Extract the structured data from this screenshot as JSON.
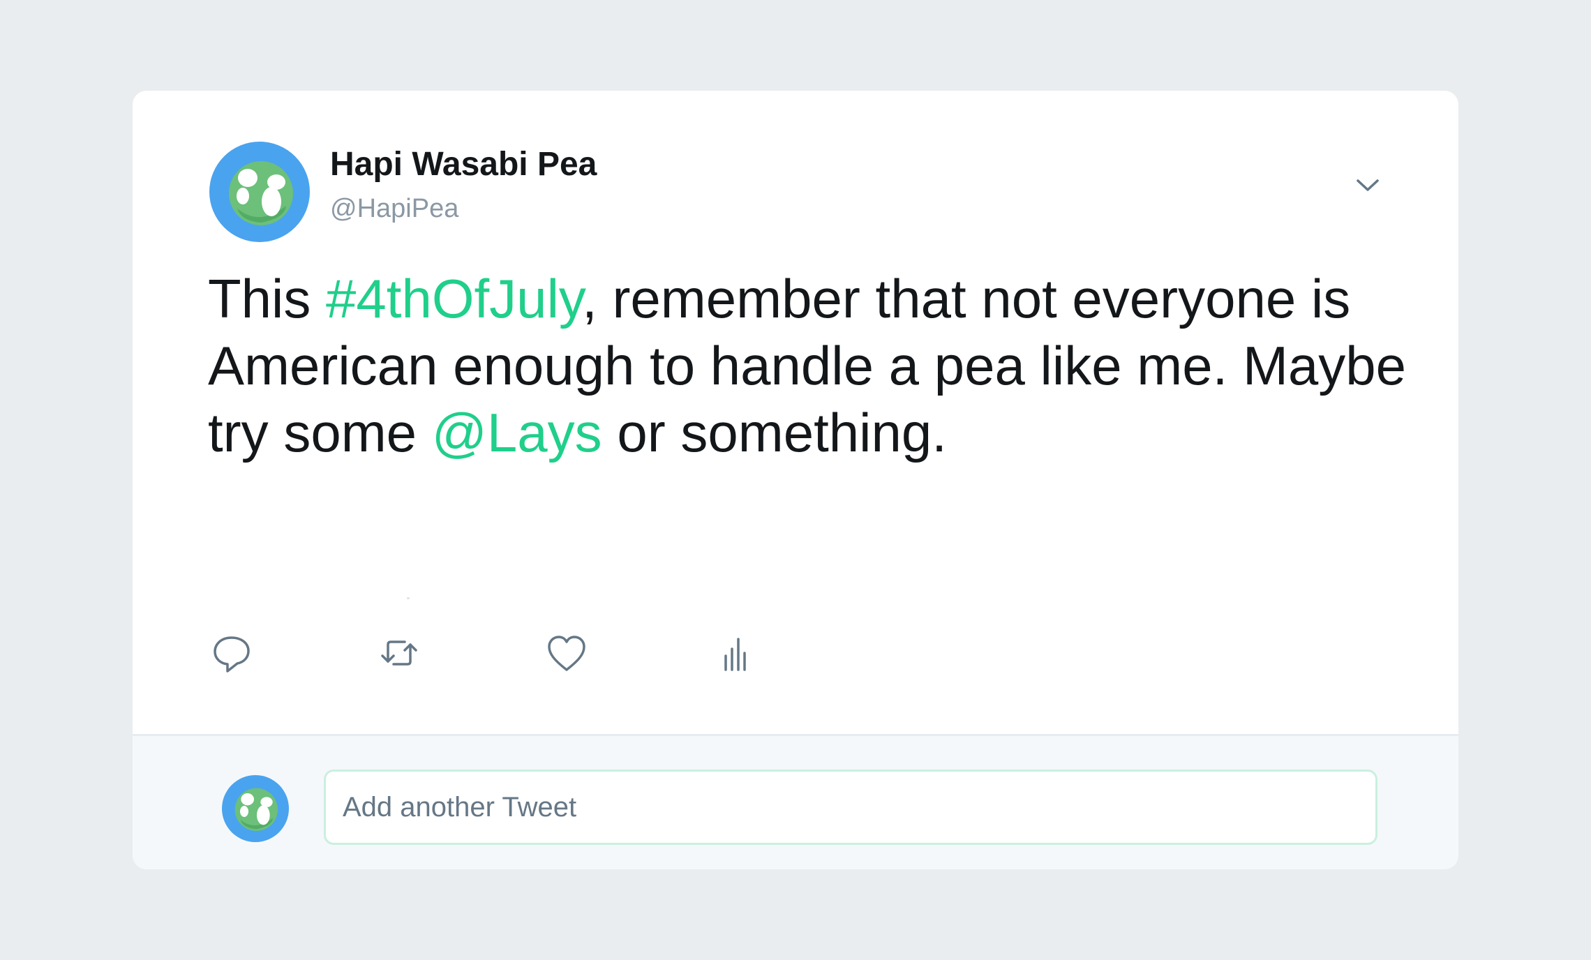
{
  "tweet": {
    "display_name": "Hapi Wasabi Pea",
    "handle": "@HapiPea",
    "text_parts": {
      "p1": "This ",
      "hashtag": "#4thOfJuly",
      "p2": ", remember that not everyone is American enough to handle a pea like me. Maybe try some ",
      "mention": "@Lays",
      "p3": " or something."
    }
  },
  "reply": {
    "placeholder": "Add another Tweet"
  },
  "icons": {
    "menu": "chevron-down-icon",
    "reply": "reply-icon",
    "retweet": "retweet-icon",
    "like": "heart-icon",
    "analytics": "analytics-icon"
  },
  "colors": {
    "background": "#e9edf0",
    "card": "#ffffff",
    "text": "#14171a",
    "secondary_text": "#8b98a5",
    "link": "#1fcf8a",
    "avatar_blue": "#4aa3ee",
    "pea_green": "#6cc07a",
    "icon_gray": "#657786",
    "input_border": "#c9f0df"
  }
}
